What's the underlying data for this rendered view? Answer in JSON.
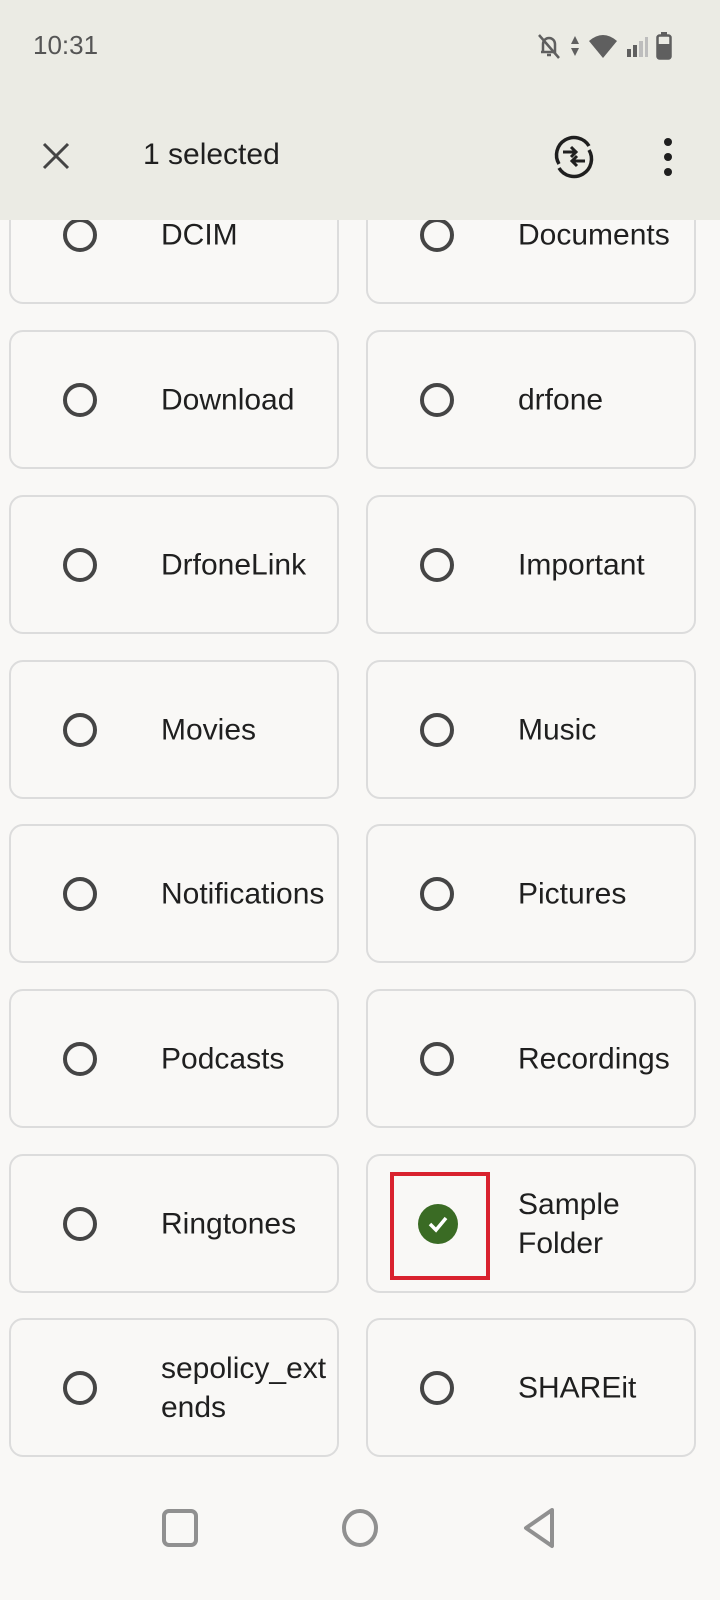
{
  "status_bar": {
    "time": "10:31",
    "icons": [
      "notifications-off-icon",
      "data-arrows-icon",
      "wifi-icon",
      "signal-icon",
      "battery-icon"
    ]
  },
  "app_bar": {
    "close_icon": "close-icon",
    "title": "1 selected",
    "switch_icon": "swap-icon",
    "more_icon": "more-vert-icon"
  },
  "folders": [
    {
      "name": "DCIM",
      "selected": false
    },
    {
      "name": "Documents",
      "selected": false
    },
    {
      "name": "Download",
      "selected": false
    },
    {
      "name": "drfone",
      "selected": false
    },
    {
      "name": "DrfoneLink",
      "selected": false
    },
    {
      "name": "Important",
      "selected": false
    },
    {
      "name": "Movies",
      "selected": false
    },
    {
      "name": "Music",
      "selected": false
    },
    {
      "name": "Notifications",
      "selected": false
    },
    {
      "name": "Pictures",
      "selected": false
    },
    {
      "name": "Podcasts",
      "selected": false
    },
    {
      "name": "Recordings",
      "selected": false
    },
    {
      "name": "Ringtones",
      "selected": false
    },
    {
      "name": "Sample Folder",
      "selected": true
    },
    {
      "name": "sepolicy_extends",
      "selected": false
    },
    {
      "name": "SHAREit",
      "selected": false
    }
  ],
  "colors": {
    "selected_check": "#3a6b24",
    "highlight_border": "#d9222e",
    "header_bg": "#ebebe4"
  },
  "nav_bar": {
    "recents": "recents-icon",
    "home": "home-icon",
    "back": "back-icon"
  }
}
